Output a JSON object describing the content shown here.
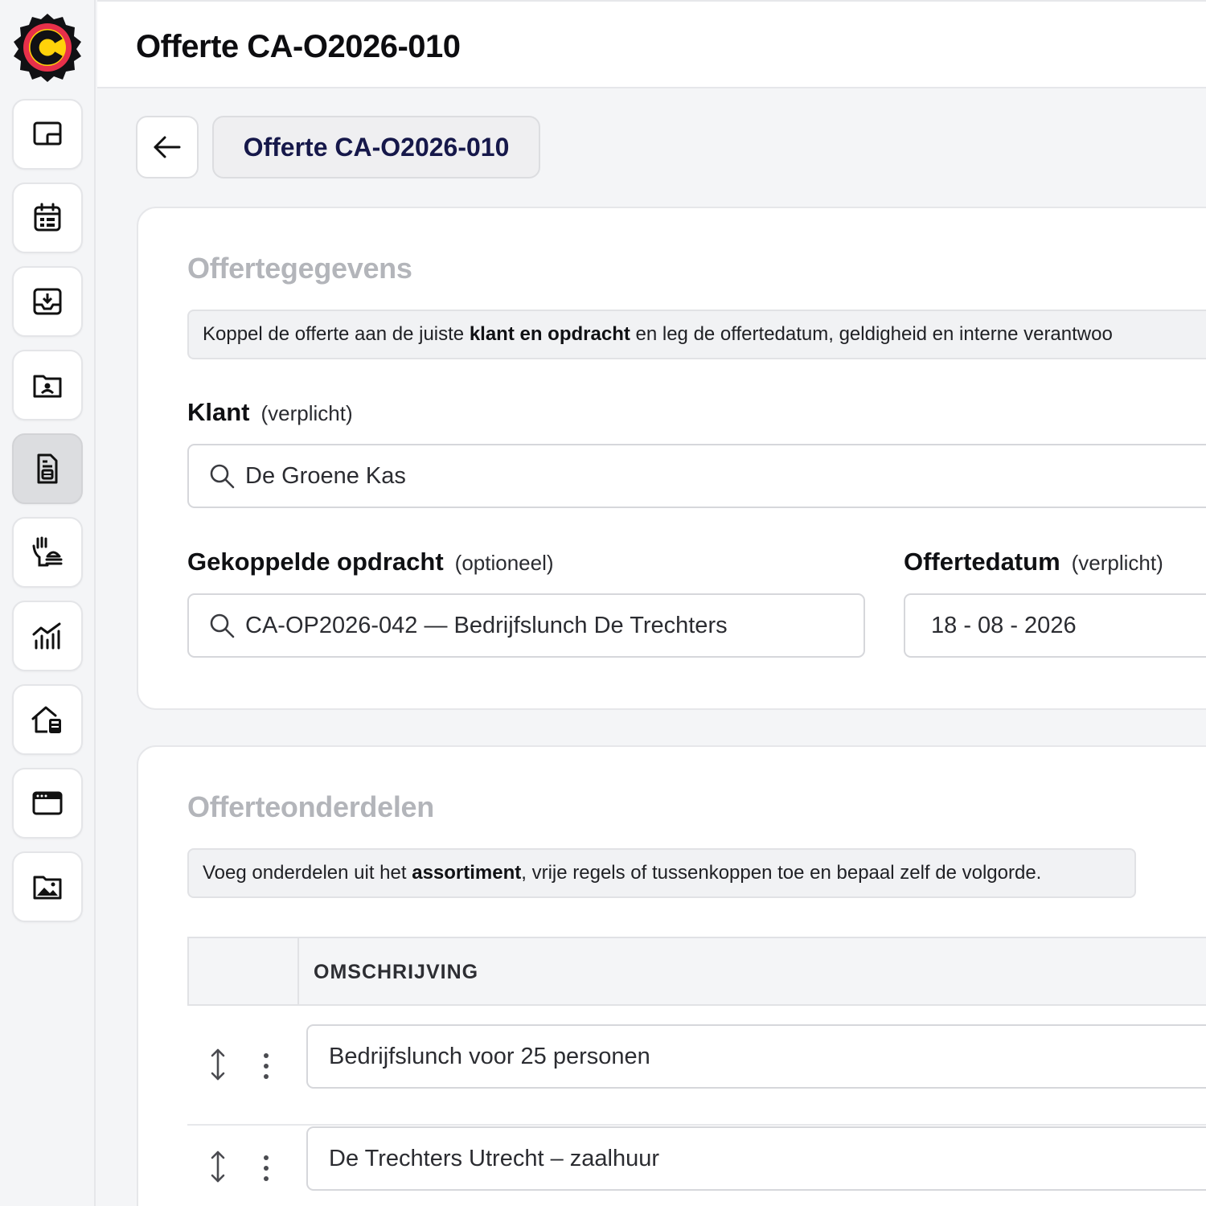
{
  "app": {
    "page_title": "Offerte CA-O2026-010",
    "brand_colors": {
      "logo_ring": "#e8304a",
      "logo_fill": "#ffd20a",
      "accent_text": "#16184a"
    }
  },
  "sidebar": {
    "items": [
      {
        "icon": "dashboard-icon",
        "active": false
      },
      {
        "icon": "calendar-icon",
        "active": false
      },
      {
        "icon": "inbox-download-icon",
        "active": false
      },
      {
        "icon": "client-folder-icon",
        "active": false
      },
      {
        "icon": "quote-document-icon",
        "active": true
      },
      {
        "icon": "catering-hand-icon",
        "active": false
      },
      {
        "icon": "analytics-chart-icon",
        "active": false
      },
      {
        "icon": "house-calculator-icon",
        "active": false
      },
      {
        "icon": "browser-window-icon",
        "active": false
      },
      {
        "icon": "image-folder-icon",
        "active": false
      }
    ]
  },
  "header": {
    "chip_title": "Offerte CA-O2026-010"
  },
  "details": {
    "section_title": "Offertegegevens",
    "info_before": "Koppel de offerte aan de juiste ",
    "info_bold": "klant en opdracht",
    "info_after": " en leg de offertedatum, geldigheid en interne verantwoo",
    "client": {
      "label": "Klant",
      "hint": "(verplicht)",
      "value": "De Groene Kas"
    },
    "assignment": {
      "label": "Gekoppelde opdracht",
      "hint": "(optioneel)",
      "value": "CA-OP2026-042 — Bedrijfslunch De Trechters"
    },
    "quote_date": {
      "label": "Offertedatum",
      "hint": "(verplicht)",
      "value": "18 - 08 - 2026"
    }
  },
  "lines": {
    "section_title": "Offerteonderdelen",
    "info_before": "Voeg onderdelen uit het ",
    "info_bold": "assortiment",
    "info_after": ", vrije regels of tussenkoppen toe en bepaal zelf de volgorde.",
    "column_description": "OMSCHRIJVING",
    "rows": [
      {
        "description": "Bedrijfslunch voor 25 personen"
      },
      {
        "description": "De Trechters Utrecht – zaalhuur"
      }
    ]
  }
}
